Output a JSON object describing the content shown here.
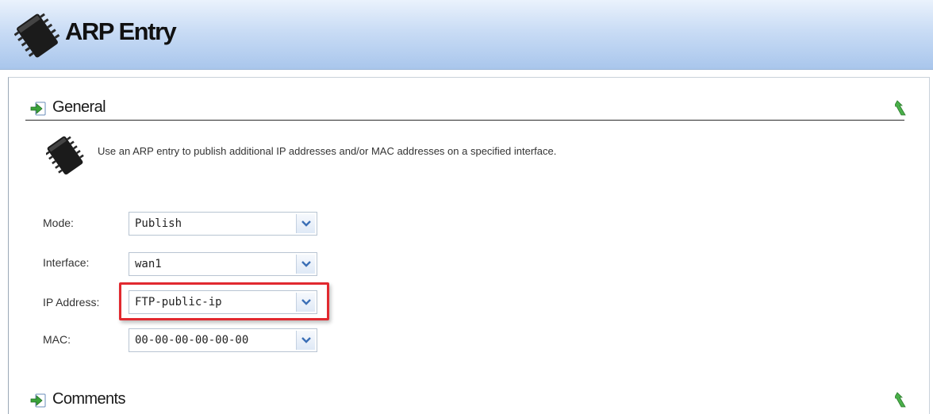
{
  "header": {
    "title": "ARP Entry",
    "icon": "chip-icon"
  },
  "sections": {
    "general": {
      "title": "General"
    },
    "comments": {
      "title": "Comments"
    }
  },
  "info": {
    "text": "Use an ARP entry to publish additional IP addresses and/or MAC addresses on a specified interface."
  },
  "fields": {
    "mode": {
      "label": "Mode:",
      "value": "Publish"
    },
    "interface": {
      "label": "Interface:",
      "value": "wan1"
    },
    "ip_address": {
      "label": "IP Address:",
      "value": "FTP-public-ip"
    },
    "mac": {
      "label": "MAC:",
      "value": "00-00-00-00-00-00"
    }
  },
  "colors": {
    "highlight": "#e1292f",
    "header_gradient": "#a9c6ec",
    "collapse_arrow": "#3fa13a"
  }
}
